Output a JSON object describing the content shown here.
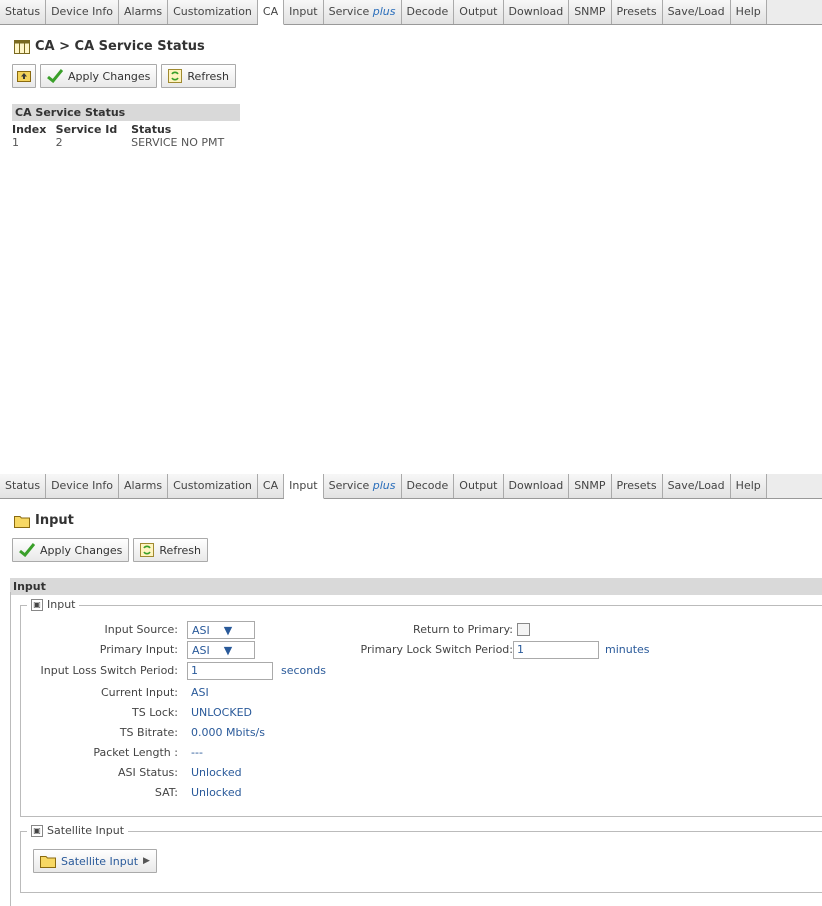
{
  "tabs": [
    "Status",
    "Device Info",
    "Alarms",
    "Customization",
    "CA",
    "Input",
    "Service",
    "plus",
    "Decode",
    "Output",
    "Download",
    "SNMP",
    "Presets",
    "Save/Load",
    "Help"
  ],
  "top": {
    "active_tab": "CA",
    "title": "CA > CA Service Status",
    "apply_label": "Apply Changes",
    "refresh_label": "Refresh",
    "section_title": "CA Service Status",
    "columns": [
      "Index",
      "Service Id",
      "Status"
    ],
    "rows": [
      [
        "1",
        "2",
        "SERVICE NO PMT"
      ]
    ]
  },
  "bottom": {
    "active_tab": "Input",
    "title": "Input",
    "apply_label": "Apply Changes",
    "refresh_label": "Refresh",
    "section_title": "Input",
    "group_input": "Input",
    "fields": {
      "input_source_label": "Input Source:",
      "input_source_value": "ASI",
      "primary_input_label": "Primary Input:",
      "primary_input_value": "ASI",
      "loss_switch_label": "Input Loss Switch Period:",
      "loss_switch_value": "1",
      "loss_switch_unit": "seconds",
      "current_input_label": "Current Input:",
      "current_input_value": "ASI",
      "ts_lock_label": "TS Lock:",
      "ts_lock_value": "UNLOCKED",
      "ts_bitrate_label": "TS Bitrate:",
      "ts_bitrate_value": "0.000 Mbits/s",
      "packet_length_label": "Packet Length :",
      "packet_length_value": "---",
      "asi_status_label": "ASI Status:",
      "asi_status_value": "Unlocked",
      "sat_label": "SAT:",
      "sat_value": "Unlocked",
      "return_primary_label": "Return to Primary:",
      "primary_lock_label": "Primary Lock Switch Period:",
      "primary_lock_value": "1",
      "primary_lock_unit": "minutes"
    },
    "group_satellite": "Satellite Input",
    "satellite_button": "Satellite Input"
  },
  "icons": [
    "collapse-icon",
    "folder-icon",
    "checkmark-icon",
    "refresh-icon",
    "table-icon",
    "up-folder-icon",
    "arrow-right-icon",
    "dropdown-arrow-icon"
  ],
  "colors": {
    "link_blue": "#2a5a9a",
    "header_gray": "#d9d9d9",
    "check_green": "#3aa02a"
  }
}
